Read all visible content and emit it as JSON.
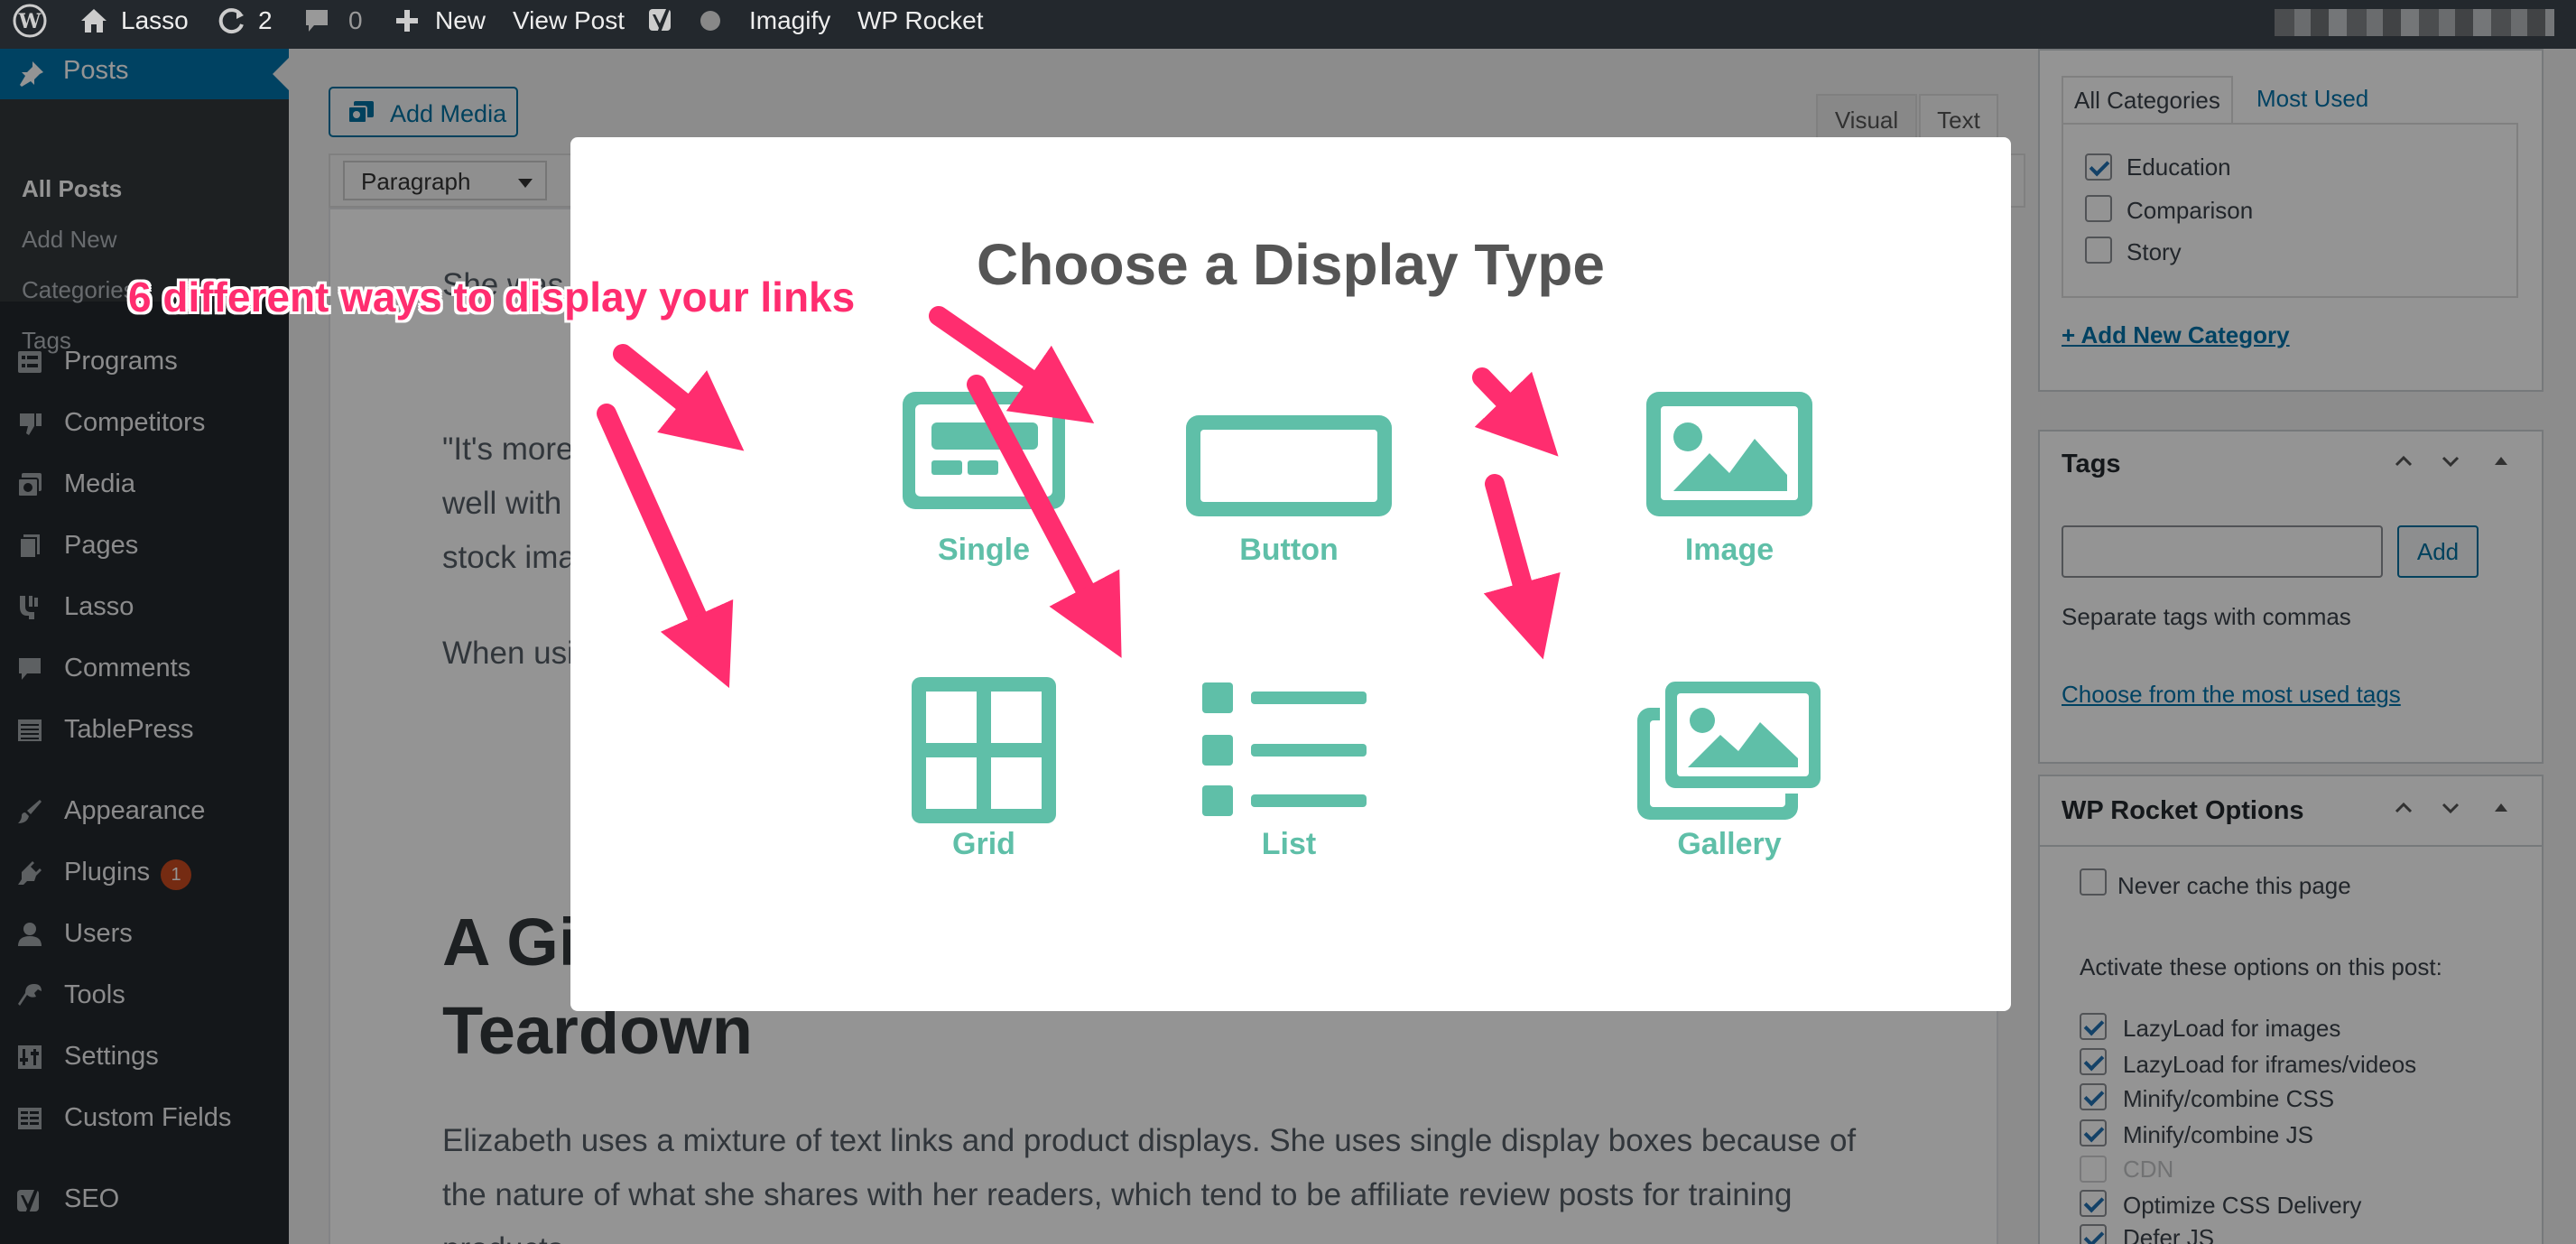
{
  "admin_bar": {
    "site_name": "Lasso",
    "updates_count": "2",
    "comments_count": "0",
    "new_label": "New",
    "view_post_label": "View Post",
    "imagify_label": "Imagify",
    "wp_rocket_label": "WP Rocket"
  },
  "sidebar": {
    "active_item": "Posts",
    "submenu": [
      "All Posts",
      "Add New",
      "Categories",
      "Tags"
    ],
    "items": [
      {
        "label": "Programs",
        "icon": "list-icon"
      },
      {
        "label": "Competitors",
        "icon": "thumbs-down-icon"
      },
      {
        "label": "Media",
        "icon": "media-icon"
      },
      {
        "label": "Pages",
        "icon": "pages-icon"
      },
      {
        "label": "Lasso",
        "icon": "lasso-icon"
      },
      {
        "label": "Comments",
        "icon": "comment-icon"
      },
      {
        "label": "TablePress",
        "icon": "table-icon"
      },
      {
        "label": "Appearance",
        "icon": "brush-icon"
      },
      {
        "label": "Plugins",
        "icon": "plug-icon",
        "badge": "1"
      },
      {
        "label": "Users",
        "icon": "user-icon"
      },
      {
        "label": "Tools",
        "icon": "wrench-icon"
      },
      {
        "label": "Settings",
        "icon": "settings-icon"
      },
      {
        "label": "Custom Fields",
        "icon": "fields-icon"
      },
      {
        "label": "SEO",
        "icon": "yoast-icon"
      }
    ]
  },
  "editor": {
    "add_media_label": "Add Media",
    "tab_visual": "Visual",
    "tab_text": "Text",
    "format_select": "Paragraph",
    "text_line1": "She was",
    "text_line3": "\"It's more",
    "text_line4": "well with",
    "text_line5": "stock ima",
    "text_line6": "When usi",
    "heading_line1": "A Gi",
    "heading_line2": "Teardown",
    "para_line1": "Elizabeth uses a mixture of text links and product displays. She uses single display boxes because of",
    "para_line2": "the nature of what she shares with her readers, which tend to be affiliate review posts for training",
    "para_line3": "products."
  },
  "categories": {
    "tab_all": "All Categories",
    "tab_most_used": "Most Used",
    "items": [
      {
        "label": "Education",
        "checked": true
      },
      {
        "label": "Comparison",
        "checked": false
      },
      {
        "label": "Story",
        "checked": false
      }
    ],
    "add_new_link": "+ Add New Category"
  },
  "tags": {
    "title": "Tags",
    "input_value": "",
    "add_button": "Add",
    "help_text": "Separate tags with commas",
    "choose_link": "Choose from the most used tags"
  },
  "wp_rocket": {
    "title": "WP Rocket Options",
    "never_cache_label": "Never cache this page",
    "never_cache_checked": false,
    "activate_text": "Activate these options on this post:",
    "options": [
      {
        "label": "LazyLoad for images",
        "checked": true,
        "disabled": false
      },
      {
        "label": "LazyLoad for iframes/videos",
        "checked": true,
        "disabled": false
      },
      {
        "label": "Minify/combine CSS",
        "checked": true,
        "disabled": false
      },
      {
        "label": "Minify/combine JS",
        "checked": true,
        "disabled": false
      },
      {
        "label": "CDN",
        "checked": false,
        "disabled": true
      },
      {
        "label": "Optimize CSS Delivery",
        "checked": true,
        "disabled": false
      },
      {
        "label": "Defer JS",
        "checked": true,
        "disabled": false
      }
    ]
  },
  "modal": {
    "title": "Choose a Display Type",
    "accent_color": "#5fbfa8",
    "options": [
      {
        "label": "Single",
        "icon": "single-display-icon"
      },
      {
        "label": "Button",
        "icon": "button-display-icon"
      },
      {
        "label": "Image",
        "icon": "image-display-icon"
      },
      {
        "label": "Grid",
        "icon": "grid-display-icon"
      },
      {
        "label": "List",
        "icon": "list-display-icon"
      },
      {
        "label": "Gallery",
        "icon": "gallery-display-icon"
      }
    ]
  },
  "annotation": {
    "text": "6 different ways to display your links",
    "color": "#ff2d6f"
  }
}
